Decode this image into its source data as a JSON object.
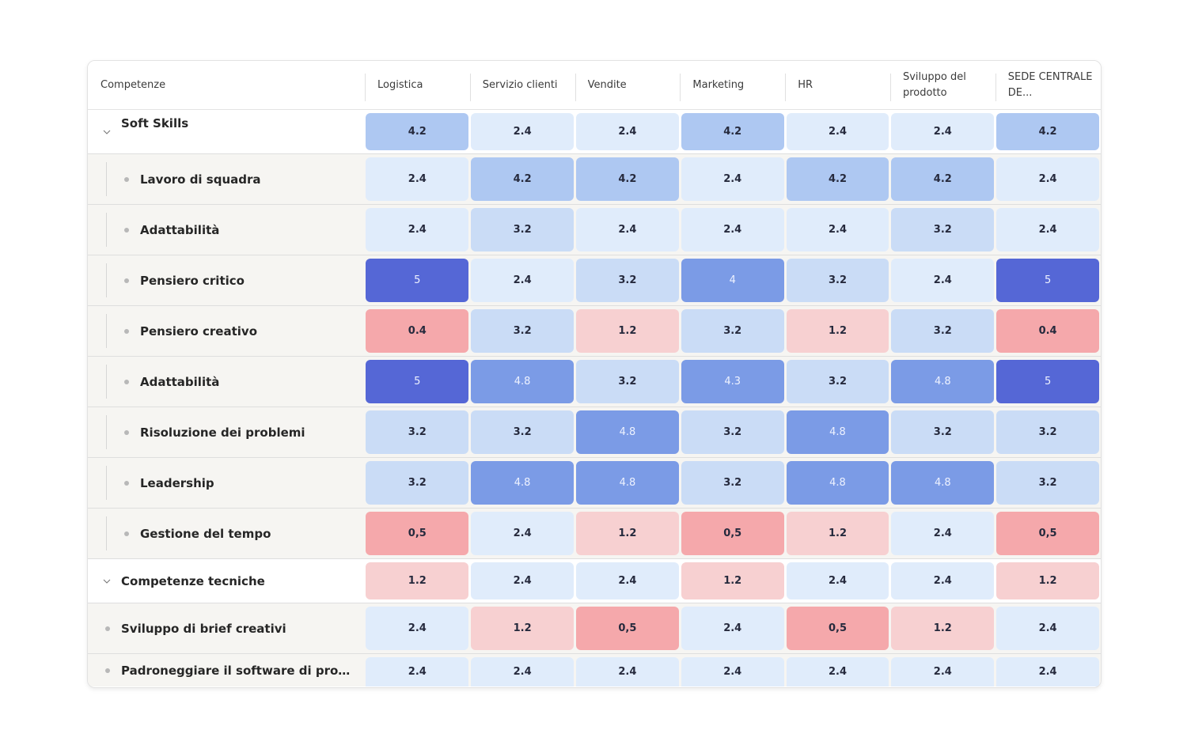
{
  "table": {
    "first_column_header": "Competenze",
    "columns": [
      "Logistica",
      "Servizio clienti",
      "Vendite",
      "Marketing",
      "HR",
      "Sviluppo del prodotto",
      "SEDE CENTRALE DE..."
    ],
    "rows": [
      {
        "type": "group",
        "label": "Soft Skills",
        "values": [
          "4.2",
          "2.4",
          "2.4",
          "4.2",
          "2.4",
          "2.4",
          "4.2"
        ]
      },
      {
        "type": "child",
        "label": "Lavoro di squadra",
        "values": [
          "2.4",
          "4.2",
          "4.2",
          "2.4",
          "4.2",
          "4.2",
          "2.4"
        ]
      },
      {
        "type": "child",
        "label": "Adattabilità",
        "values": [
          "2.4",
          "3.2",
          "2.4",
          "2.4",
          "2.4",
          "3.2",
          "2.4"
        ]
      },
      {
        "type": "child",
        "label": "Pensiero critico",
        "values": [
          "5",
          "2.4",
          "3.2",
          "4",
          "3.2",
          "2.4",
          "5"
        ]
      },
      {
        "type": "child",
        "label": "Pensiero creativo",
        "values": [
          "0.4",
          "3.2",
          "1.2",
          "3.2",
          "1.2",
          "3.2",
          "0.4"
        ]
      },
      {
        "type": "child",
        "label": "Adattabilità",
        "values": [
          "5",
          "4.8",
          "3.2",
          "4.3",
          "3.2",
          "4.8",
          "5"
        ]
      },
      {
        "type": "child",
        "label": "Risoluzione dei problemi",
        "values": [
          "3.2",
          "3.2",
          "4.8",
          "3.2",
          "4.8",
          "3.2",
          "3.2"
        ]
      },
      {
        "type": "child",
        "label": "Leadership",
        "values": [
          "3.2",
          "4.8",
          "4.8",
          "3.2",
          "4.8",
          "4.8",
          "3.2"
        ]
      },
      {
        "type": "child",
        "label": "Gestione del tempo",
        "values": [
          "0,5",
          "2.4",
          "1.2",
          "0,5",
          "1.2",
          "2.4",
          "0,5"
        ]
      },
      {
        "type": "group",
        "label": "Competenze tecniche",
        "values": [
          "1.2",
          "2.4",
          "2.4",
          "1.2",
          "2.4",
          "2.4",
          "1.2"
        ]
      },
      {
        "type": "child-flat",
        "label": "Sviluppo di brief creativi",
        "values": [
          "2.4",
          "1.2",
          "0,5",
          "2.4",
          "0,5",
          "1.2",
          "2.4"
        ]
      },
      {
        "type": "child-flat",
        "label": "Padroneggiare il software di progetta...",
        "values": [
          "2.4",
          "2.4",
          "2.4",
          "2.4",
          "2.4",
          "2.4",
          "2.4"
        ]
      }
    ]
  },
  "color_scale": {
    "very_low": "#f5a8ab",
    "low": "#f7d0d1",
    "mid_low": "#e0ecfb",
    "mid": "#cadcf6",
    "mid_high": "#aec8f2",
    "high": "#7b9be6",
    "max": "#5567d6"
  },
  "icons": {
    "expand": "chevron-down-icon",
    "item": "bullet-icon"
  }
}
